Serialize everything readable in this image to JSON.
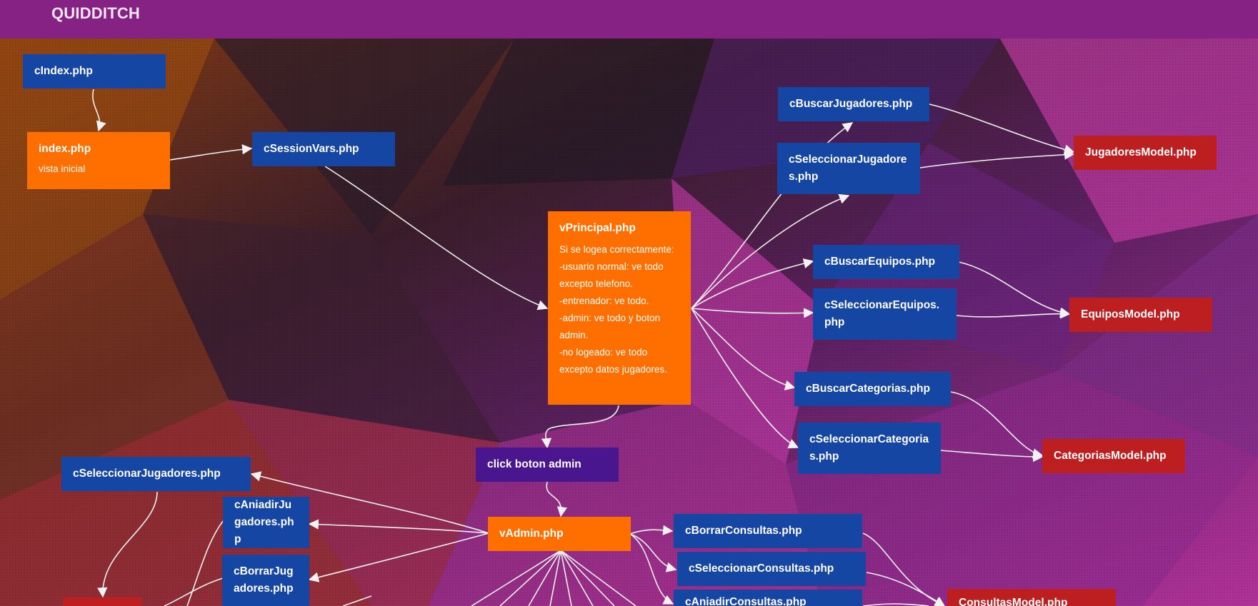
{
  "header": {
    "title": "QUIDDITCH"
  },
  "colors": {
    "header": "#862283",
    "controller": "#1546a3",
    "view": "#ff6f00",
    "model": "#bd1f20",
    "action": "#4a1690",
    "link": "#f2f2f2"
  },
  "nodes": {
    "cindex": "cIndex.php",
    "index": "index.php",
    "index_note": "vista inicial",
    "csessionvars": "cSessionVars.php",
    "vprincipal": "vPrincipal.php",
    "vprincipal_note": "Si se logea correctamente:\n-usuario normal: ve todo excepto telefono.\n-entrenador: ve todo.\n-admin: ve todo y boton admin.\n-no logeado: ve todo excepto datos jugadores.",
    "cbuscarjugadores": "cBuscarJugadores.php",
    "cseleccionarjugadores_a": "cSeleccionarJugadores.php",
    "jugadoresmodel": "JugadoresModel.php",
    "cbuscarequipos": "cBuscarEquipos.php",
    "cseleccionarequipos": "cSeleccionarEquipos.php",
    "equiposmodel": "EquiposModel.php",
    "cbuscarcategorias": "cBuscarCategorias.php",
    "cseleccionarcategorias": "cSeleccionarCategorias.php",
    "categoriasmodel": "CategoriasModel.php",
    "clickbotonadmin": "click boton admin",
    "vadmin": "vAdmin.php",
    "cseleccionarjugadores_b": "cSeleccionarJugadores.php",
    "caniadirjugadores": "cAniadirJugadores.php",
    "cborrarjugadores": "cBorrarJugadores.php",
    "cborrarconsultas": "cBorrarConsultas.php",
    "cseleccionarconsultas": "cSeleccionarConsultas.php",
    "caniadirconsultas": "cAniadirConsultas.php",
    "consultasmodel": "ConsultasModel.php"
  }
}
